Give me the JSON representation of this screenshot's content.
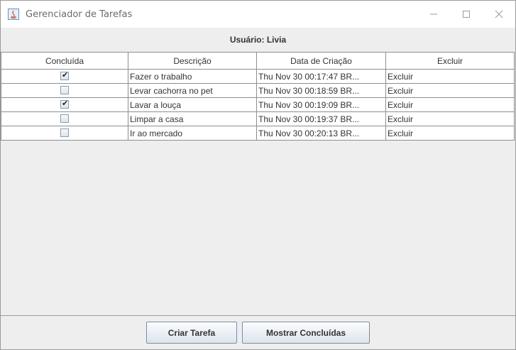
{
  "window": {
    "title": "Gerenciador de Tarefas",
    "controls": {
      "minimize_icon": "minimize-icon",
      "maximize_icon": "maximize-icon",
      "close_icon": "close-icon"
    }
  },
  "user_label": "Usuário: Livia",
  "table": {
    "headers": [
      "Concluída",
      "Descrição",
      "Data de Criação",
      "Excluir"
    ],
    "rows": [
      {
        "done": true,
        "description": "Fazer o trabalho",
        "created": "Thu Nov 30 00:17:47 BR...",
        "delete": "Excluir"
      },
      {
        "done": false,
        "description": "Levar cachorra no pet",
        "created": "Thu Nov 30 00:18:59 BR...",
        "delete": "Excluir"
      },
      {
        "done": true,
        "description": "Lavar a louça",
        "created": "Thu Nov 30 00:19:09 BR...",
        "delete": "Excluir"
      },
      {
        "done": false,
        "description": "Limpar a casa",
        "created": "Thu Nov 30 00:19:37 BR...",
        "delete": "Excluir"
      },
      {
        "done": false,
        "description": "Ir ao mercado",
        "created": "Thu Nov 30 00:20:13 BR...",
        "delete": "Excluir"
      }
    ]
  },
  "buttons": {
    "create": "Criar Tarefa",
    "show_done": "Mostrar Concluídas"
  }
}
